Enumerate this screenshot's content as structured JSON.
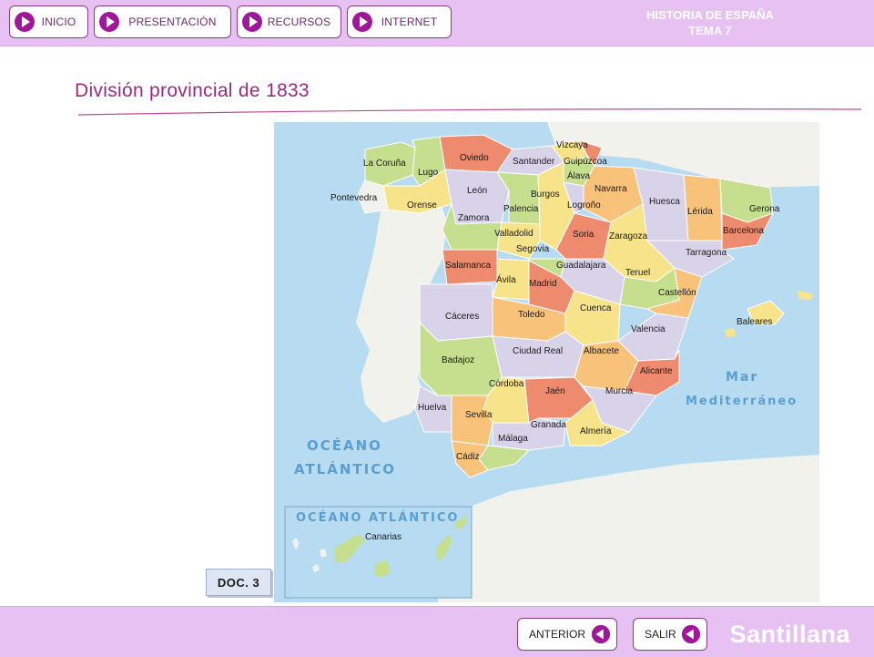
{
  "nav": {
    "inicio": "INICIO",
    "presentacion": "PRESENTACIÓN",
    "recursos": "RECURSOS",
    "internet": "INTERNET"
  },
  "header": {
    "line1": "HISTORIA DE ESPAÑA",
    "line2": "TEMA 7"
  },
  "title": "División provincial de 1833",
  "map": {
    "seas": {
      "oceano1": "OCÉANO",
      "oceano2": "ATLÁNTICO",
      "mar1": "Mar",
      "mar2": "Mediterráneo",
      "inset": "OCÉANO ATLÁNTICO",
      "canarias": "Canarias"
    },
    "provinces": {
      "vizcaya": "Vizcaya",
      "lacoruna": "La Coruña",
      "oviedo": "Oviedo",
      "santander": "Santander",
      "guipuzcoa": "Guipúzcoa",
      "alava": "Álava",
      "navarra": "Navarra",
      "lugo": "Lugo",
      "pontevedra": "Pontevedra",
      "leon": "León",
      "burgos": "Burgos",
      "logrono": "Logroño",
      "huesca": "Huesca",
      "gerona": "Gerona",
      "orense": "Orense",
      "palencia": "Palencia",
      "lerida": "Lérida",
      "zamora": "Zamora",
      "soria": "Soria",
      "barcelona": "Barcelona",
      "valladolid": "Valladolid",
      "zaragoza": "Zaragoza",
      "segovia": "Segovia",
      "tarragona": "Tarragona",
      "salamanca": "Salamanca",
      "guadalajara": "Guadalajara",
      "teruel": "Teruel",
      "avila": "Ávila",
      "madrid": "Madrid",
      "castellon": "Castellón",
      "cuenca": "Cuenca",
      "caceres": "Cáceres",
      "toledo": "Toledo",
      "baleares": "Baleares",
      "valencia": "Valencia",
      "ciudadreal": "Ciudad Real",
      "albacete": "Albacete",
      "badajoz": "Badajoz",
      "alicante": "Alicante",
      "cordoba": "Córdoba",
      "jaen": "Jaén",
      "murcia": "Murcia",
      "huelva": "Huelva",
      "sevilla": "Sevilla",
      "granada": "Granada",
      "almeria": "Almería",
      "malaga": "Málaga",
      "cadiz": "Cádiz"
    },
    "colors": {
      "sea": "#b7dcf2",
      "land": "#f2f2ec",
      "yellow": "#f7e48a",
      "orange": "#f8c27a",
      "red": "#ee8a6e",
      "green": "#c5df8e",
      "lavender": "#d9d3ea"
    }
  },
  "doc": "DOC. 3",
  "bottom": {
    "anterior": "ANTERIOR",
    "salir": "SALIR",
    "brand": "Santillana"
  },
  "colors": {
    "bar": "#e8c1f3",
    "accent": "#a0189a",
    "title": "#9a2a7c"
  }
}
